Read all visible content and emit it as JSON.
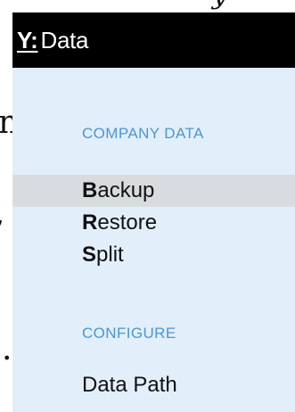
{
  "background": {
    "glyph_top": "y",
    "glyph_1": "n",
    "glyph_2": ",",
    "glyph_3": "."
  },
  "menu": {
    "hotkey": "Y:",
    "title": "Data",
    "sections": [
      {
        "label": "COMPANY DATA",
        "items": [
          {
            "hotkey": "B",
            "rest": "ackup",
            "selected": true
          },
          {
            "hotkey": "R",
            "rest": "estore",
            "selected": false
          },
          {
            "hotkey": "S",
            "rest": "plit",
            "selected": false
          }
        ]
      },
      {
        "label": "CONFIGURE",
        "items": [
          {
            "hotkey": "",
            "rest": "Data Path",
            "selected": false
          }
        ]
      }
    ]
  },
  "colors": {
    "menu_background": "#e2eef9",
    "header_background": "#000000",
    "section_label": "#4a97d2",
    "selected_item": "#d9dcdf"
  }
}
